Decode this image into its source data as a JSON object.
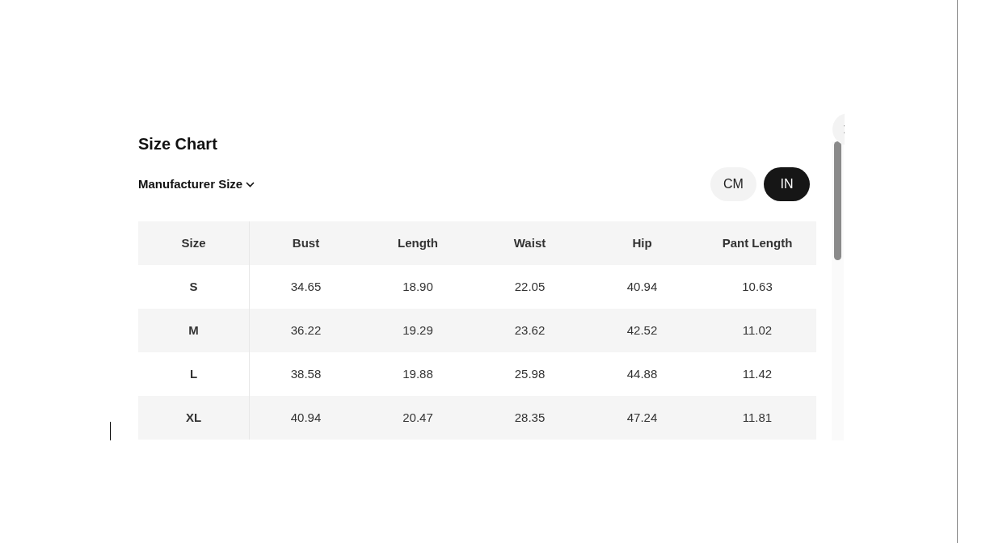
{
  "title": "Size Chart",
  "size_system": {
    "label": "Manufacturer Size"
  },
  "units": [
    {
      "label": "CM",
      "selected": false
    },
    {
      "label": "IN",
      "selected": true
    }
  ],
  "table": {
    "columns": [
      "Size",
      "Bust",
      "Length",
      "Waist",
      "Hip",
      "Pant Length"
    ],
    "rows": [
      [
        "S",
        "34.65",
        "18.90",
        "22.05",
        "40.94",
        "10.63"
      ],
      [
        "M",
        "36.22",
        "19.29",
        "23.62",
        "42.52",
        "11.02"
      ],
      [
        "L",
        "38.58",
        "19.88",
        "25.98",
        "44.88",
        "11.42"
      ],
      [
        "XL",
        "40.94",
        "20.47",
        "28.35",
        "47.24",
        "11.81"
      ]
    ]
  }
}
